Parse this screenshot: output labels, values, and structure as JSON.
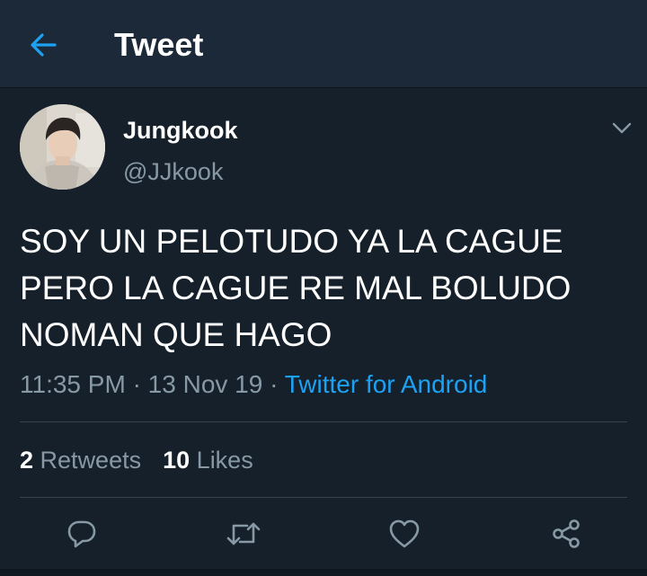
{
  "header": {
    "title": "Tweet",
    "back_icon": "arrow-left-icon"
  },
  "tweet": {
    "author": {
      "display_name": "Jungkook",
      "handle": "@JJkook",
      "avatar": "profile-photo"
    },
    "text_lines": [
      "SOY UN PELOTUDO YA LA CAGUE",
      "PERO LA CAGUE RE MAL BOLUDO",
      "NOMAN QUE HAGO"
    ],
    "time": "11:35 PM",
    "separator": "·",
    "date": "13 Nov 19",
    "source": "Twitter for Android",
    "stats": {
      "retweets_count": "2",
      "retweets_label": "Retweets",
      "likes_count": "10",
      "likes_label": "Likes"
    },
    "actions": [
      "reply-icon",
      "retweet-icon",
      "like-icon",
      "share-icon"
    ]
  },
  "colors": {
    "background": "#15202b",
    "header_background": "#1c2938",
    "accent": "#1da1f2",
    "secondary_text": "#8899a6",
    "divider": "#38444d"
  }
}
